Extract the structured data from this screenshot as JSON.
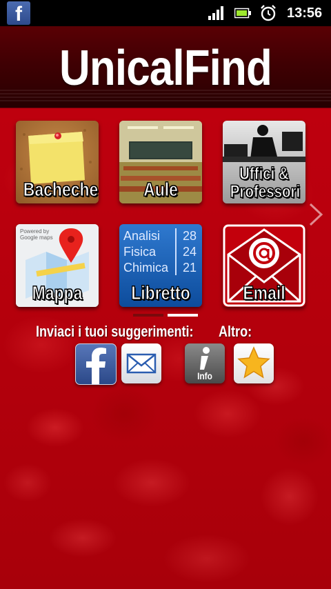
{
  "status_bar": {
    "notification_icon": "facebook-icon",
    "icons": [
      "signal-icon",
      "battery-icon",
      "alarm-clock-icon"
    ],
    "time": "13:56"
  },
  "header": {
    "title": "UnicalFind"
  },
  "tiles": [
    {
      "label": "Bacheche",
      "icon": "corkboard-postit-icon"
    },
    {
      "label": "Aule",
      "icon": "classroom-photo"
    },
    {
      "label": "Uffici &\nProfessori",
      "icon": "office-silhouette-icon"
    },
    {
      "label": "Mappa",
      "icon": "google-maps-icon",
      "badge": "Powered by Google maps"
    },
    {
      "label": "Libretto",
      "icon": "gradebook-icon",
      "grades": [
        {
          "subject": "Analisi",
          "score": "28"
        },
        {
          "subject": "Fisica",
          "score": "24"
        },
        {
          "subject": "Chimica",
          "score": "21"
        }
      ]
    },
    {
      "label": "Email",
      "icon": "envelope-at-icon"
    }
  ],
  "pager": {
    "pages": 2,
    "current": 2
  },
  "feedback": {
    "label": "Inviaci i tuoi suggerimenti:",
    "buttons": [
      {
        "name": "facebook",
        "icon": "facebook-icon"
      },
      {
        "name": "email",
        "icon": "mail-icon"
      }
    ]
  },
  "other": {
    "label": "Altro:",
    "buttons": [
      {
        "name": "info",
        "icon": "info-icon",
        "label": "Info"
      },
      {
        "name": "rate",
        "icon": "star-icon"
      }
    ]
  },
  "colors": {
    "background": "#b5000c",
    "header": "#3a0003",
    "accent": "#ffffff"
  }
}
